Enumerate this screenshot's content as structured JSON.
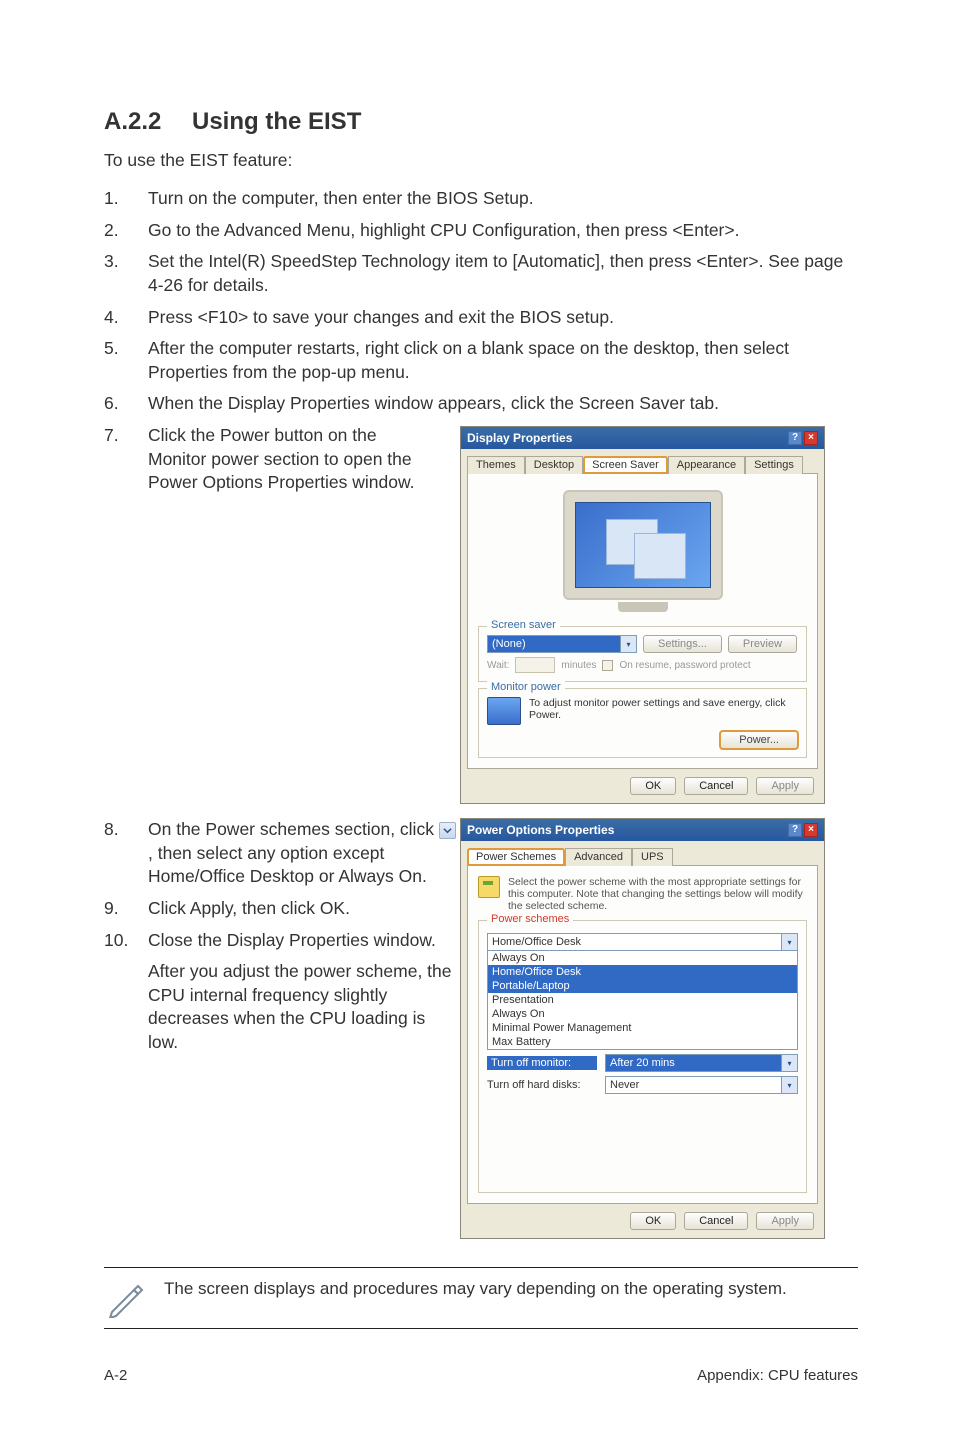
{
  "heading": {
    "num": "A.2.2",
    "title": "Using the EIST"
  },
  "intro": "To use the EIST feature:",
  "steps": {
    "s1n": "1.",
    "s1": "Turn on the computer, then enter the BIOS Setup.",
    "s2n": "2.",
    "s2": "Go to the Advanced Menu, highlight CPU Configuration, then press <Enter>.",
    "s3n": "3.",
    "s3": "Set the Intel(R) SpeedStep Technology item to [Automatic], then press <Enter>. See page 4-26 for details.",
    "s4n": "4.",
    "s4": "Press <F10> to save your changes and exit the BIOS setup.",
    "s5n": "5.",
    "s5": "After the computer restarts, right click on a blank space on the desktop, then select Properties from the pop-up menu.",
    "s6n": "6.",
    "s6": "When the Display Properties window appears, click the Screen Saver tab.",
    "s7n": "7.",
    "s7": "Click the Power button on the Monitor power section to open the Power Options Properties window.",
    "s8n": "8.",
    "s8a": "On the Power schemes section, click ",
    "s8b": ", then select any option except Home/Office Desktop or Always On.",
    "s9n": "9.",
    "s9": "Click Apply, then click OK.",
    "s10n": "10.",
    "s10": "Close the Display Properties window.",
    "s10after": "After you adjust the power scheme, the CPU internal frequency slightly decreases when the CPU loading is low."
  },
  "display_dialog": {
    "title": "Display Properties",
    "tabs": {
      "themes": "Themes",
      "desktop": "Desktop",
      "screensaver": "Screen Saver",
      "appearance": "Appearance",
      "settings": "Settings"
    },
    "group_saver": "Screen saver",
    "saver_value": "(None)",
    "btn_settings": "Settings...",
    "btn_preview": "Preview",
    "wait_label": "Wait:",
    "wait_mins": "minutes",
    "resume_label": "On resume, password protect",
    "group_monitor": "Monitor power",
    "monitor_text": "To adjust monitor power settings and save energy, click Power.",
    "btn_power": "Power...",
    "btn_ok": "OK",
    "btn_cancel": "Cancel",
    "btn_apply": "Apply"
  },
  "power_dialog": {
    "title": "Power Options Properties",
    "tabs": {
      "schemes": "Power Schemes",
      "advanced": "Advanced",
      "ups": "UPS"
    },
    "desc": "Select the power scheme with the most appropriate settings for this computer. Note that changing the settings below will modify the selected scheme.",
    "group_schemes": "Power schemes",
    "selected_scheme": "Home/Office Desk",
    "scheme_options": [
      "Always On",
      "Home/Office Desk",
      "Portable/Laptop",
      "Presentation",
      "Always On",
      "Minimal Power Management",
      "Max Battery"
    ],
    "row_monitor_lbl": "Turn off monitor:",
    "row_monitor_val": "After 20 mins",
    "row_hdd_lbl": "Turn off hard disks:",
    "row_hdd_val": "Never",
    "btn_ok": "OK",
    "btn_cancel": "Cancel",
    "btn_apply": "Apply"
  },
  "note": "The screen displays and procedures may vary depending on the operating system.",
  "footer": {
    "left": "A-2",
    "right": "Appendix: CPU features"
  }
}
